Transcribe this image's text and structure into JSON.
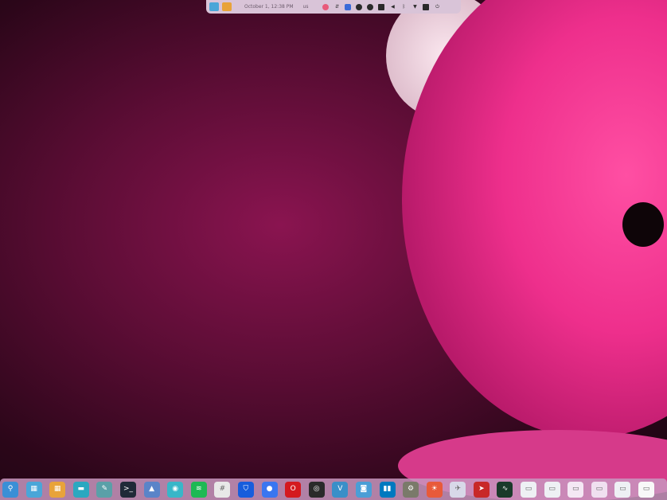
{
  "top_panel": {
    "clock": "October 1, 12:38 PM",
    "keyboard_layout": "us"
  },
  "tray_icons": [
    "app-indicator-icon",
    "network-speed-icon",
    "chat-icon",
    "spotify-icon",
    "sync-icon",
    "display-icon",
    "volume-icon",
    "bluetooth-icon",
    "wifi-icon",
    "battery-icon",
    "power-icon"
  ],
  "dock": {
    "items": [
      {
        "name": "search-icon",
        "color": "#3a8fd6",
        "glyph": "⚲"
      },
      {
        "name": "workspaces-icon",
        "color": "#4aa6d8",
        "glyph": "▦"
      },
      {
        "name": "app-grid-icon",
        "color": "#e8a33a",
        "glyph": "▦"
      },
      {
        "name": "files-icon",
        "color": "#2aa8c0",
        "glyph": "▬"
      },
      {
        "name": "text-editor-icon",
        "color": "#5aa0a8",
        "glyph": "✎"
      },
      {
        "name": "terminal-icon",
        "color": "#1f2a38",
        "glyph": ">_"
      },
      {
        "name": "software-store-icon",
        "color": "#5a84c8",
        "glyph": "▲"
      },
      {
        "name": "screenshot-icon",
        "color": "#38b6c8",
        "glyph": "◉"
      },
      {
        "name": "spotify-icon",
        "color": "#1db954",
        "glyph": "≋"
      },
      {
        "name": "slack-icon",
        "color": "#e8e8e8",
        "glyph": "#"
      },
      {
        "name": "bitwarden-icon",
        "color": "#175ddc",
        "glyph": "⛉"
      },
      {
        "name": "signal-icon",
        "color": "#3a76f0",
        "glyph": "●"
      },
      {
        "name": "opera-icon",
        "color": "#d41a1f",
        "glyph": "O"
      },
      {
        "name": "record-icon",
        "color": "#2a2a2a",
        "glyph": "◎"
      },
      {
        "name": "vectorizer-icon",
        "color": "#3a8fc8",
        "glyph": "V"
      },
      {
        "name": "camera-icon",
        "color": "#4a9ed6",
        "glyph": "◙"
      },
      {
        "name": "trello-icon",
        "color": "#0079bf",
        "glyph": "▮▮"
      },
      {
        "name": "settings-icon",
        "color": "#7a7a6a",
        "glyph": "⚙"
      },
      {
        "name": "weather-icon",
        "color": "#e85a3a",
        "glyph": "☀"
      },
      {
        "name": "goose-icon",
        "color": "#d8d8e8",
        "glyph": "✈"
      },
      {
        "name": "send-icon",
        "color": "#c82828",
        "glyph": "➤"
      },
      {
        "name": "system-monitor-icon",
        "color": "#1a3a2a",
        "glyph": "∿"
      },
      {
        "name": "window-preview-1-icon",
        "color": "#eef0f4",
        "glyph": "▭"
      },
      {
        "name": "window-preview-2-icon",
        "color": "#eef0f4",
        "glyph": "▭"
      },
      {
        "name": "window-preview-3-icon",
        "color": "#f4e8f4",
        "glyph": "▭"
      },
      {
        "name": "window-preview-4-icon",
        "color": "#f0e0f0",
        "glyph": "▭"
      },
      {
        "name": "window-preview-5-icon",
        "color": "#eef0f4",
        "glyph": "▭"
      },
      {
        "name": "window-preview-6-icon",
        "color": "#f8f8f8",
        "glyph": "▭"
      }
    ]
  }
}
